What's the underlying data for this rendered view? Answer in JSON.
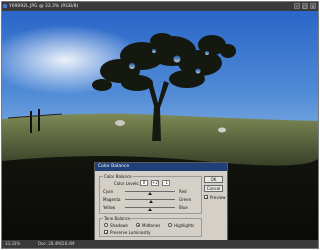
{
  "window": {
    "title": "Y09092L.JPG @ 33.3% (RGB/8)"
  },
  "status": {
    "zoom": "33.33%",
    "doc_info": "Doc: 28.4M/28.4M"
  },
  "dialog": {
    "title": "Color Balance",
    "color_balance": {
      "legend": "Color Balance",
      "levels_label": "Color Levels:",
      "levels": [
        "0",
        "+2",
        "-1"
      ],
      "sliders": [
        {
          "left": "Cyan",
          "right": "Red",
          "level": 0
        },
        {
          "left": "Magenta",
          "right": "Green",
          "level": 2
        },
        {
          "left": "Yellow",
          "right": "Blue",
          "level": -1
        }
      ]
    },
    "tone_balance": {
      "legend": "Tone Balance",
      "options": [
        "Shadows",
        "Midtones",
        "Highlights"
      ],
      "selected": "Midtones",
      "preserve_luminosity": {
        "label": "Preserve Luminosity",
        "checked": true
      }
    },
    "buttons": {
      "ok": "OK",
      "cancel": "Cancel"
    },
    "preview": {
      "label": "Preview",
      "checked": true
    }
  },
  "colors": {
    "sky_top": "#2f6fd0",
    "sky_horizon": "#c8dcef",
    "grass": "#6a7748",
    "dialog_bg": "#d4d0c8",
    "title_bar": "#20407a"
  }
}
